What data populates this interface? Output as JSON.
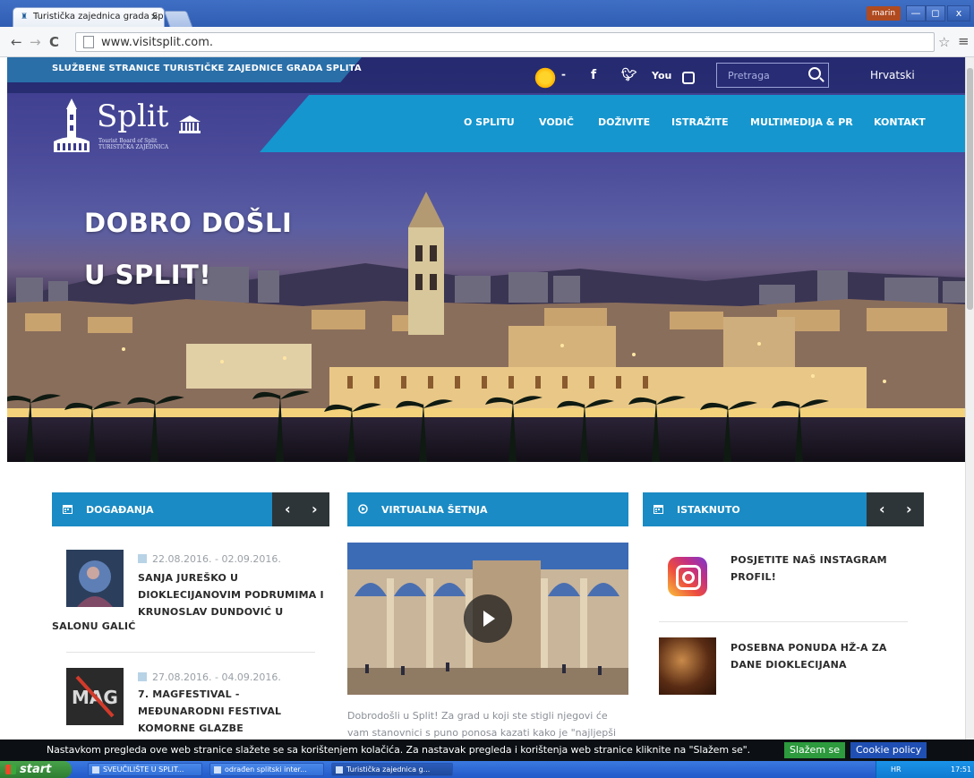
{
  "browser": {
    "tab_title": "Turistička zajednica grada Sp",
    "tab_close": "×",
    "url": "www.visitsplit.com.",
    "user": "marin",
    "window_controls": {
      "min": "—",
      "max": "◻",
      "close": "x"
    },
    "nav": {
      "back": "←",
      "forward": "→",
      "reload": "C",
      "star": "☆",
      "menu": "≡"
    }
  },
  "site": {
    "tagline": "SLUŽBENE STRANICE TURISTIČKE ZAJEDNICE GRADA SPLITA",
    "weather_dash": "-",
    "social": {
      "facebook": "f",
      "twitter": "🐦",
      "youtube": "You"
    },
    "search_placeholder": "Pretraga",
    "language": "Hrvatski",
    "logo": {
      "word": "Split",
      "sub_line1": "Tourist Board of Split",
      "sub_line2": "TURISTIČKA ZAJEDNICA"
    },
    "nav_items": [
      "O SPLITU",
      "VODIČ",
      "DOŽIVITE",
      "ISTRAŽITE",
      "MULTIMEDIJA & PR",
      "KONTAKT"
    ],
    "hero": {
      "line1": "DOBRO DOŠLI",
      "line2": "U SPLIT!"
    }
  },
  "panels": {
    "dogadanja": {
      "title": "DOGAĐANJA",
      "prev": "‹",
      "next": "›",
      "events": [
        {
          "date": "22.08.2016. - 02.09.2016.",
          "title": "SANJA JUREŠKO U DIOKLECIJANOVIM PODRUMIMA I KRUNOSLAV DUNDOVIĆ U",
          "title_tail": "SALONU GALIĆ"
        },
        {
          "date": "27.08.2016. - 04.09.2016.",
          "title": "7. MAGFESTIVAL - MEĐUNARODNI FESTIVAL KOMORNE GLAZBE",
          "thumb_text": "MAG"
        }
      ]
    },
    "virtualna": {
      "title": "VIRTUALNA ŠETNJA",
      "text": "Dobrodošli u Split! Za grad u koji ste stigli njegovi će vam stanovnici s puno ponosa kazati kako je \"najljepši"
    },
    "istaknuto": {
      "title": "ISTAKNUTO",
      "prev": "‹",
      "next": "›",
      "items": [
        {
          "title": "POSJETITE NAŠ INSTAGRAM PROFIL!"
        },
        {
          "title": "POSEBNA PONUDA HŽ-A ZA DANE DIOKLECIJANA"
        }
      ]
    }
  },
  "cookie": {
    "text": "Nastavkom pregleda ove web stranice slažete se sa korištenjem kolačića. Za nastavak pregleda i korištenja web stranice kliknite na \"Slažem se\".",
    "agree": "Slažem se",
    "policy": "Cookie policy"
  },
  "taskbar": {
    "start": "start",
    "tasks": [
      "SVEUČILIŠTE U SPLIT...",
      "odrađen splitski inter...",
      "Turistička zajednica g..."
    ],
    "tray_lang": "HR",
    "clock": "17:51"
  },
  "colors": {
    "accent_blue": "#1596cf",
    "panel_blue": "#1a8bc4",
    "panel_dark": "#2d3538",
    "cookie_green": "#2c9a3d",
    "cookie_blue": "#1f4fb3"
  }
}
